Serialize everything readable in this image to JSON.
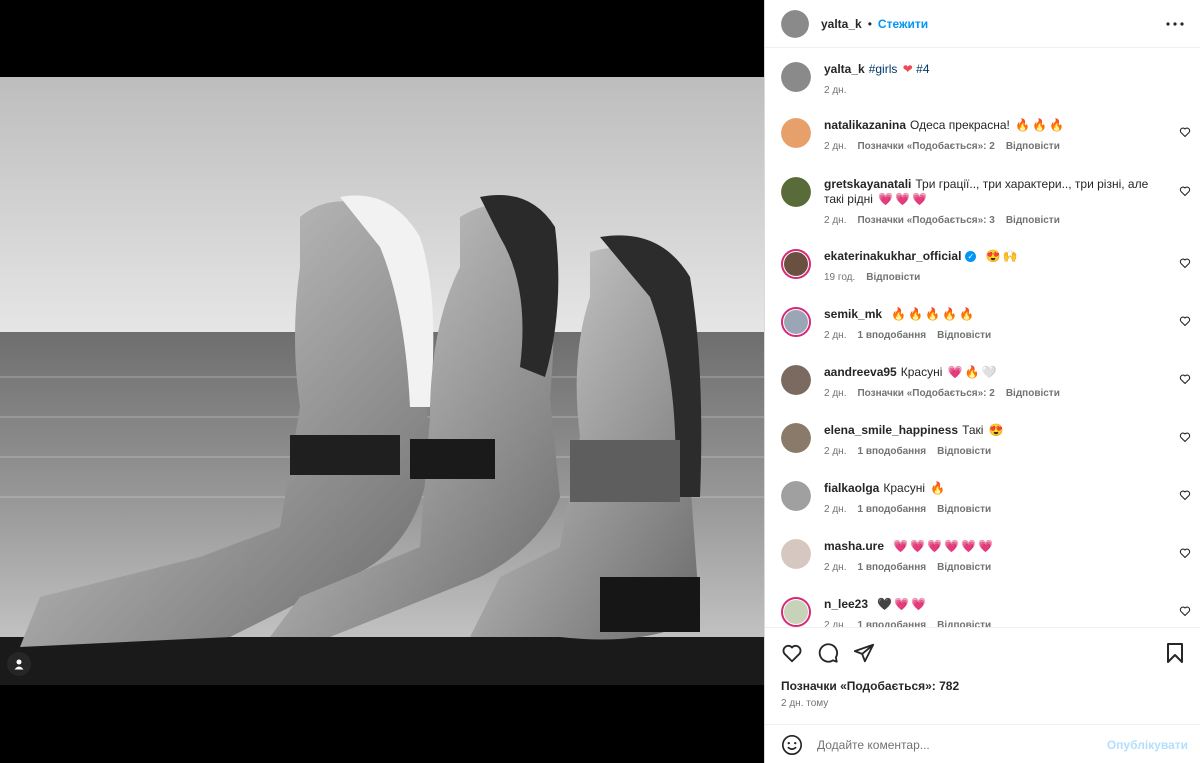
{
  "post": {
    "author": "yalta_k",
    "separator": "•",
    "follow_label": "Стежити"
  },
  "caption": {
    "user": "yalta_k",
    "hashtag1": "#girls",
    "hashtag2": "#4",
    "time": "2 дн."
  },
  "comments": [
    {
      "user": "natalikazanina",
      "text": "Одеса прекрасна!",
      "emojis": [
        "🔥",
        "🔥",
        "🔥"
      ],
      "time": "2 дн.",
      "likes": "Позначки «Подобається»: 2",
      "reply": "Відповісти"
    },
    {
      "user": "gretskayanatali",
      "text": "Три грації.., три характери.., три різні, але такі рідні",
      "emojis": [
        "💗",
        "💗",
        "💗"
      ],
      "time": "2 дн.",
      "likes": "Позначки «Подобається»: 3",
      "reply": "Відповісти"
    },
    {
      "user": "ekaterinakukhar_official",
      "text": "",
      "emojis": [
        "😍",
        "🙌"
      ],
      "time": "19 год.",
      "likes": "",
      "reply": "Відповісти"
    },
    {
      "user": "semik_mk",
      "text": "",
      "emojis": [
        "🔥",
        "🔥",
        "🔥",
        "🔥",
        "🔥"
      ],
      "time": "2 дн.",
      "likes": "1 вподобання",
      "reply": "Відповісти"
    },
    {
      "user": "aandreeva95",
      "text": "Красуні",
      "emojis": [
        "💗",
        "🔥",
        "🤍"
      ],
      "time": "2 дн.",
      "likes": "Позначки «Подобається»: 2",
      "reply": "Відповісти"
    },
    {
      "user": "elena_smile_happiness",
      "text": "Такі",
      "emojis": [
        "😍"
      ],
      "time": "2 дн.",
      "likes": "1 вподобання",
      "reply": "Відповісти"
    },
    {
      "user": "fialkaolga",
      "text": "Красуні",
      "emojis": [
        "🔥"
      ],
      "time": "2 дн.",
      "likes": "1 вподобання",
      "reply": "Відповісти"
    },
    {
      "user": "masha.ure",
      "text": "",
      "emojis": [
        "💗",
        "💗",
        "💗",
        "💗",
        "💗",
        "💗"
      ],
      "time": "2 дн.",
      "likes": "1 вподобання",
      "reply": "Відповісти"
    },
    {
      "user": "n_lee23",
      "text": "",
      "emojis": [
        "🖤",
        "💗",
        "💗"
      ],
      "time": "2 дн.",
      "likes": "1 вподобання",
      "reply": "Відповісти"
    }
  ],
  "footer": {
    "likes_text": "Позначки «Подобається»: 782",
    "time_ago": "2 дн. тому",
    "comment_placeholder": "Додайте коментар...",
    "post_label": "Опублікувати"
  },
  "colors": {
    "accent": "#0095f6",
    "like_red": "#ed4956",
    "story_ring": "#d62976"
  },
  "icons": [
    "tag-user-icon",
    "more-options-icon",
    "like-icon",
    "comment-icon",
    "share-icon",
    "save-icon",
    "emoji-icon",
    "verified-badge-icon"
  ]
}
